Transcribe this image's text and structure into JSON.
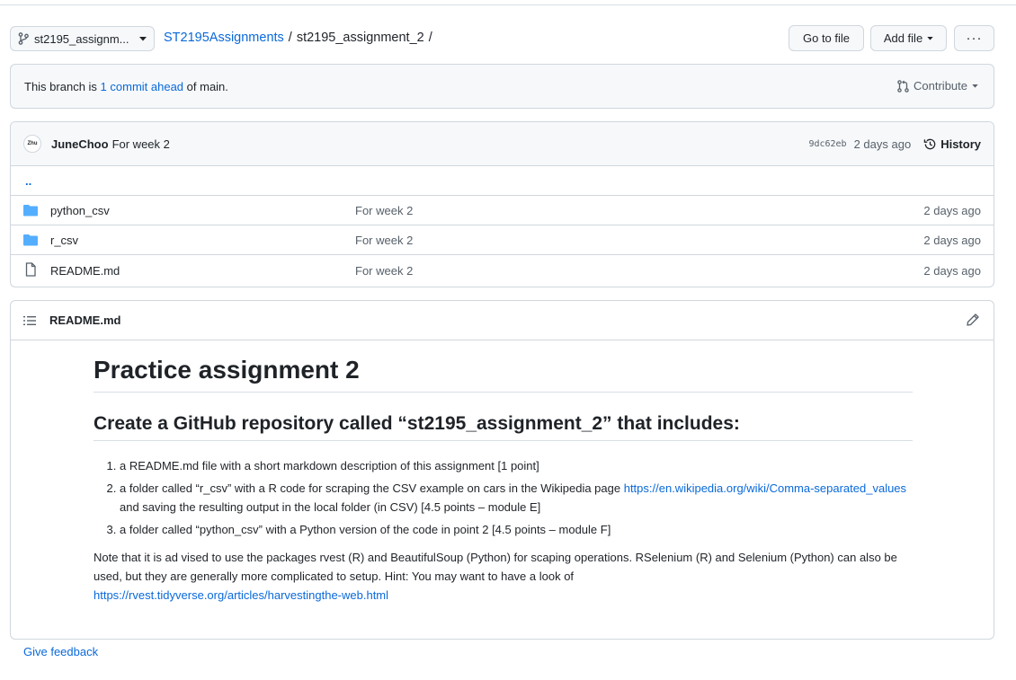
{
  "top_bar": {
    "branch_label": "st2195_assignm...",
    "repo_link": "ST2195Assignments",
    "separator1": "/",
    "current_dir": "st2195_assignment_2",
    "separator2": "/",
    "go_to_file": "Go to file",
    "add_file": "Add file",
    "more": "···"
  },
  "ahead_banner": {
    "prefix": "This branch is ",
    "link": "1 commit ahead",
    "suffix": " of main.",
    "contribute": "Contribute"
  },
  "latest_commit": {
    "avatar_text": "Zhu",
    "author": "JuneChoo",
    "message": "For week 2",
    "sha": "9dc62eb",
    "time": "2 days ago",
    "history": "History"
  },
  "parent_dir": "..",
  "files": [
    {
      "name": "python_csv",
      "type": "folder",
      "message": "For week 2",
      "date": "2 days ago"
    },
    {
      "name": "r_csv",
      "type": "folder",
      "message": "For week 2",
      "date": "2 days ago"
    },
    {
      "name": "README.md",
      "type": "file",
      "message": "For week 2",
      "date": "2 days ago"
    }
  ],
  "readme": {
    "filename": "README.md",
    "h1": "Practice assignment 2",
    "h2": "Create a GitHub repository called “st2195_assignment_2” that includes:",
    "items": [
      {
        "text": "a README.md file with a short markdown description of this assignment [1 point]"
      },
      {
        "before": "a folder called “r_csv” with a R code for scraping the CSV example on cars in the Wikipedia page ",
        "link": "https://en.wikipedia.org/wiki/Comma-separated_values",
        "after": " and saving the resulting output in the local folder (in CSV) [4.5 points – module E]"
      },
      {
        "text": "a folder called “python_csv” with a Python version of the code in point 2 [4.5 points – module F]"
      }
    ],
    "note": "Note that it is ad vised to use the packages rvest (R) and BeautifulSoup (Python) for scaping operations. RSelenium (R) and Selenium (Python) can also be used, but they are generally more complicated to setup. Hint: You may want to have a look of",
    "note_link": "https://rvest.tidyverse.org/articles/harvestingthe-web.html"
  },
  "feedback": "Give feedback",
  "colors": {
    "link": "#0969da",
    "folder_icon": "#54aeff",
    "border": "#d0d7de",
    "muted": "#57606a"
  }
}
